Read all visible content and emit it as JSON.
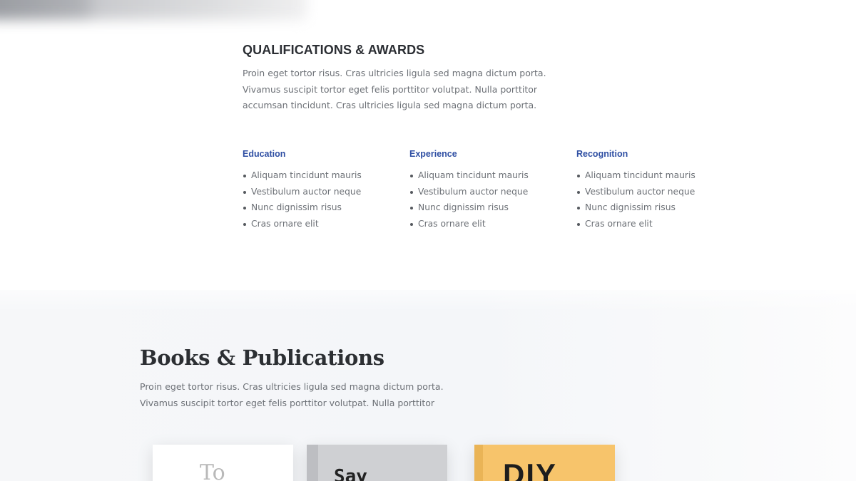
{
  "qualifications": {
    "title": "QUALIFICATIONS & AWARDS",
    "description": "Proin eget tortor risus. Cras ultricies ligula sed magna dictum porta. Vivamus suscipit tortor eget felis porttitor volutpat. Nulla porttitor accumsan tincidunt. Cras ultricies ligula sed magna dictum porta.",
    "columns": [
      {
        "title": "Education",
        "items": [
          "Aliquam tincidunt mauris",
          "Vestibulum auctor neque",
          "Nunc dignissim risus",
          "Cras ornare elit"
        ]
      },
      {
        "title": "Experience",
        "items": [
          "Aliquam tincidunt mauris",
          "Vestibulum auctor neque",
          "Nunc dignissim risus",
          "Cras ornare elit"
        ]
      },
      {
        "title": "Recognition",
        "items": [
          "Aliquam tincidunt mauris",
          "Vestibulum auctor neque",
          "Nunc dignissim risus",
          "Cras ornare elit"
        ]
      }
    ]
  },
  "books": {
    "title": "Books & Publications",
    "description": "Proin eget tortor risus. Cras ultricies ligula sed magna dictum porta. Vivamus suscipit tortor eget felis porttitor volutpat. Nulla porttitor",
    "covers": [
      {
        "text": "To",
        "color": "#ffffff"
      },
      {
        "text": "Say",
        "color": "#cfd0d3"
      },
      {
        "text": "DIY",
        "color": "#f7c46b"
      }
    ]
  },
  "colors": {
    "accent": "#2f4fa3",
    "heading": "#2b2e33",
    "body_text": "#6c7076"
  }
}
